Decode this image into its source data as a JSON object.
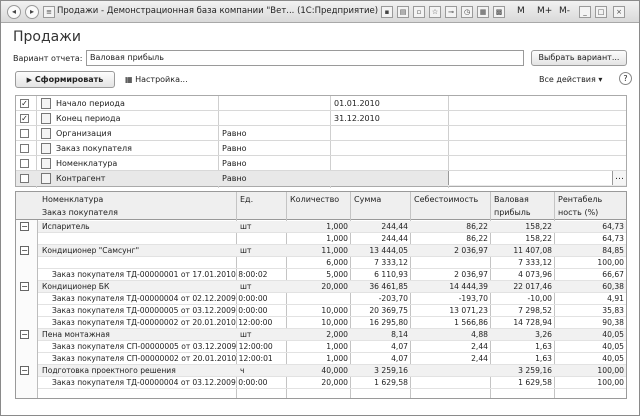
{
  "window": {
    "title": "Продажи - Демонстрационная база компании \"Вет...  (1С:Предприятие)",
    "m_label": "M",
    "mplus_label": "M+",
    "mminus_label": "M-",
    "minimize": "_",
    "restore": "□",
    "close": "×"
  },
  "page": {
    "heading": "Продажи"
  },
  "variant": {
    "label": "Вариант отчета:",
    "value": "Валовая прибыль",
    "choose_button": "Выбрать вариант..."
  },
  "toolbar": {
    "generate_button": "Сформировать",
    "settings_label": "Настройка...",
    "all_actions": "Все действия",
    "help": "?"
  },
  "settings": {
    "rows": [
      {
        "checked": true,
        "name": "Начало периода",
        "comparison": "",
        "value": "01.01.2010"
      },
      {
        "checked": true,
        "name": "Конец периода",
        "comparison": "",
        "value": "31.12.2010"
      },
      {
        "checked": false,
        "name": "Организация",
        "comparison": "Равно",
        "value": ""
      },
      {
        "checked": false,
        "name": "Заказ покупателя",
        "comparison": "Равно",
        "value": ""
      },
      {
        "checked": false,
        "name": "Номенклатура",
        "comparison": "Равно",
        "value": ""
      },
      {
        "checked": false,
        "name": "Контрагент",
        "comparison": "Равно",
        "value": ""
      }
    ],
    "check_mark": "✓",
    "search_icon": "…"
  },
  "report": {
    "headers": {
      "nomenclature": "Номенклатура",
      "order": "Заказ покупателя",
      "unit": "Ед.",
      "qty": "Количество",
      "sum": "Сумма",
      "cost": "Себестоимость",
      "gross1": "Валовая",
      "gross2": "прибыль",
      "profit1": "Рентабель",
      "profit2": "ность (%)"
    },
    "rows": [
      {
        "level": 0,
        "name": "Испаритель",
        "unit": "шт",
        "qty": "1,000",
        "sum": "244,44",
        "cost": "86,22",
        "gross": "158,22",
        "profit": "64,73"
      },
      {
        "level": 1,
        "name": "",
        "unit": "",
        "qty": "1,000",
        "sum": "244,44",
        "cost": "86,22",
        "gross": "158,22",
        "profit": "64,73"
      },
      {
        "level": 0,
        "name": "Кондиционер \"Самсунг\"",
        "unit": "шт",
        "qty": "11,000",
        "sum": "13 444,05",
        "cost": "2 036,97",
        "gross": "11 407,08",
        "profit": "84,85"
      },
      {
        "level": 1,
        "name": "",
        "unit": "",
        "qty": "6,000",
        "sum": "7 333,12",
        "cost": "",
        "gross": "7 333,12",
        "profit": "100,00"
      },
      {
        "level": 1,
        "name": "Заказ покупателя ТД-00000001 от 17.01.2010 8:00:02",
        "unit": "",
        "qty": "5,000",
        "sum": "6 110,93",
        "cost": "2 036,97",
        "gross": "4 073,96",
        "profit": "66,67"
      },
      {
        "level": 0,
        "name": "Кондиционер БК",
        "unit": "шт",
        "qty": "20,000",
        "sum": "36 461,85",
        "cost": "14 444,39",
        "gross": "22 017,46",
        "profit": "60,38"
      },
      {
        "level": 1,
        "name": "Заказ покупателя ТД-00000004 от 02.12.2009 0:00:00",
        "unit": "",
        "qty": "",
        "sum": "-203,70",
        "cost": "-193,70",
        "gross": "-10,00",
        "profit": "4,91"
      },
      {
        "level": 1,
        "name": "Заказ покупателя ТД-00000005 от 03.12.2009 0:00:00",
        "unit": "",
        "qty": "10,000",
        "sum": "20 369,75",
        "cost": "13 071,23",
        "gross": "7 298,52",
        "profit": "35,83"
      },
      {
        "level": 1,
        "name": "Заказ покупателя ТД-00000002 от 20.01.2010 12:00:00",
        "unit": "",
        "qty": "10,000",
        "sum": "16 295,80",
        "cost": "1 566,86",
        "gross": "14 728,94",
        "profit": "90,38"
      },
      {
        "level": 0,
        "name": "Пена монтажная",
        "unit": "шт",
        "qty": "2,000",
        "sum": "8,14",
        "cost": "4,88",
        "gross": "3,26",
        "profit": "40,05"
      },
      {
        "level": 1,
        "name": "Заказ покупателя СП-00000005 от 03.12.2009 12:00:00",
        "unit": "",
        "qty": "1,000",
        "sum": "4,07",
        "cost": "2,44",
        "gross": "1,63",
        "profit": "40,05"
      },
      {
        "level": 1,
        "name": "Заказ покупателя СП-00000002 от 20.01.2010 12:00:01",
        "unit": "",
        "qty": "1,000",
        "sum": "4,07",
        "cost": "2,44",
        "gross": "1,63",
        "profit": "40,05"
      },
      {
        "level": 0,
        "name": "Подготовка проектного решения",
        "unit": "ч",
        "qty": "40,000",
        "sum": "3 259,16",
        "cost": "",
        "gross": "3 259,16",
        "profit": "100,00"
      },
      {
        "level": 1,
        "name": "Заказ покупателя ТД-00000004 от 03.12.2009 0:00:00",
        "unit": "",
        "qty": "20,000",
        "sum": "1 629,58",
        "cost": "",
        "gross": "1 629,58",
        "profit": "100,00"
      }
    ]
  }
}
